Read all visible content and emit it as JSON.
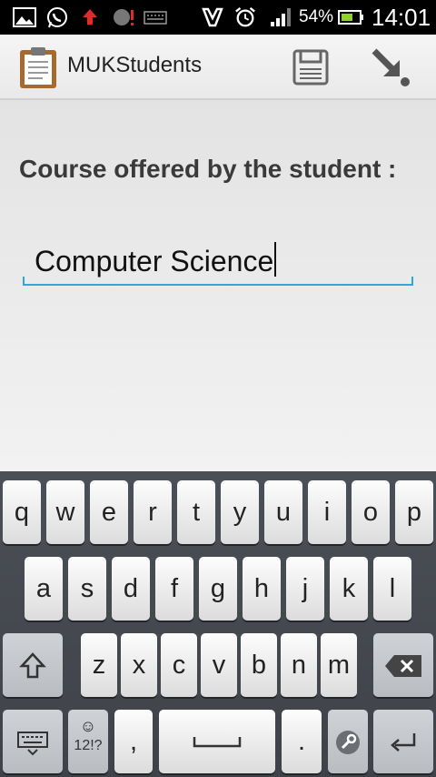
{
  "status_bar": {
    "battery_percent": "54%",
    "time": "14:01",
    "icons": [
      "gallery-icon",
      "whatsapp-icon",
      "upload-icon",
      "alert-icon",
      "keyboard-icon",
      "vibrate-icon",
      "alarm-icon",
      "signal-icon",
      "battery-icon"
    ]
  },
  "action_bar": {
    "title": "MUKStudents",
    "app_icon": "clipboard-icon",
    "actions": [
      "save-icon",
      "download-icon"
    ]
  },
  "form": {
    "label": "Course offered by the student :",
    "value": "Computer Science"
  },
  "keyboard": {
    "row1": [
      "q",
      "w",
      "e",
      "r",
      "t",
      "y",
      "u",
      "i",
      "o",
      "p"
    ],
    "row2": [
      "a",
      "s",
      "d",
      "f",
      "g",
      "h",
      "j",
      "k",
      "l"
    ],
    "row3": [
      "z",
      "x",
      "c",
      "v",
      "b",
      "n",
      "m"
    ],
    "symbols_label": "12!?",
    "comma": ",",
    "period": ".",
    "colors": {
      "accent": "#33a6d6",
      "key_bg": "#f2f2f2",
      "keyboard_bg": "#44474e"
    }
  }
}
